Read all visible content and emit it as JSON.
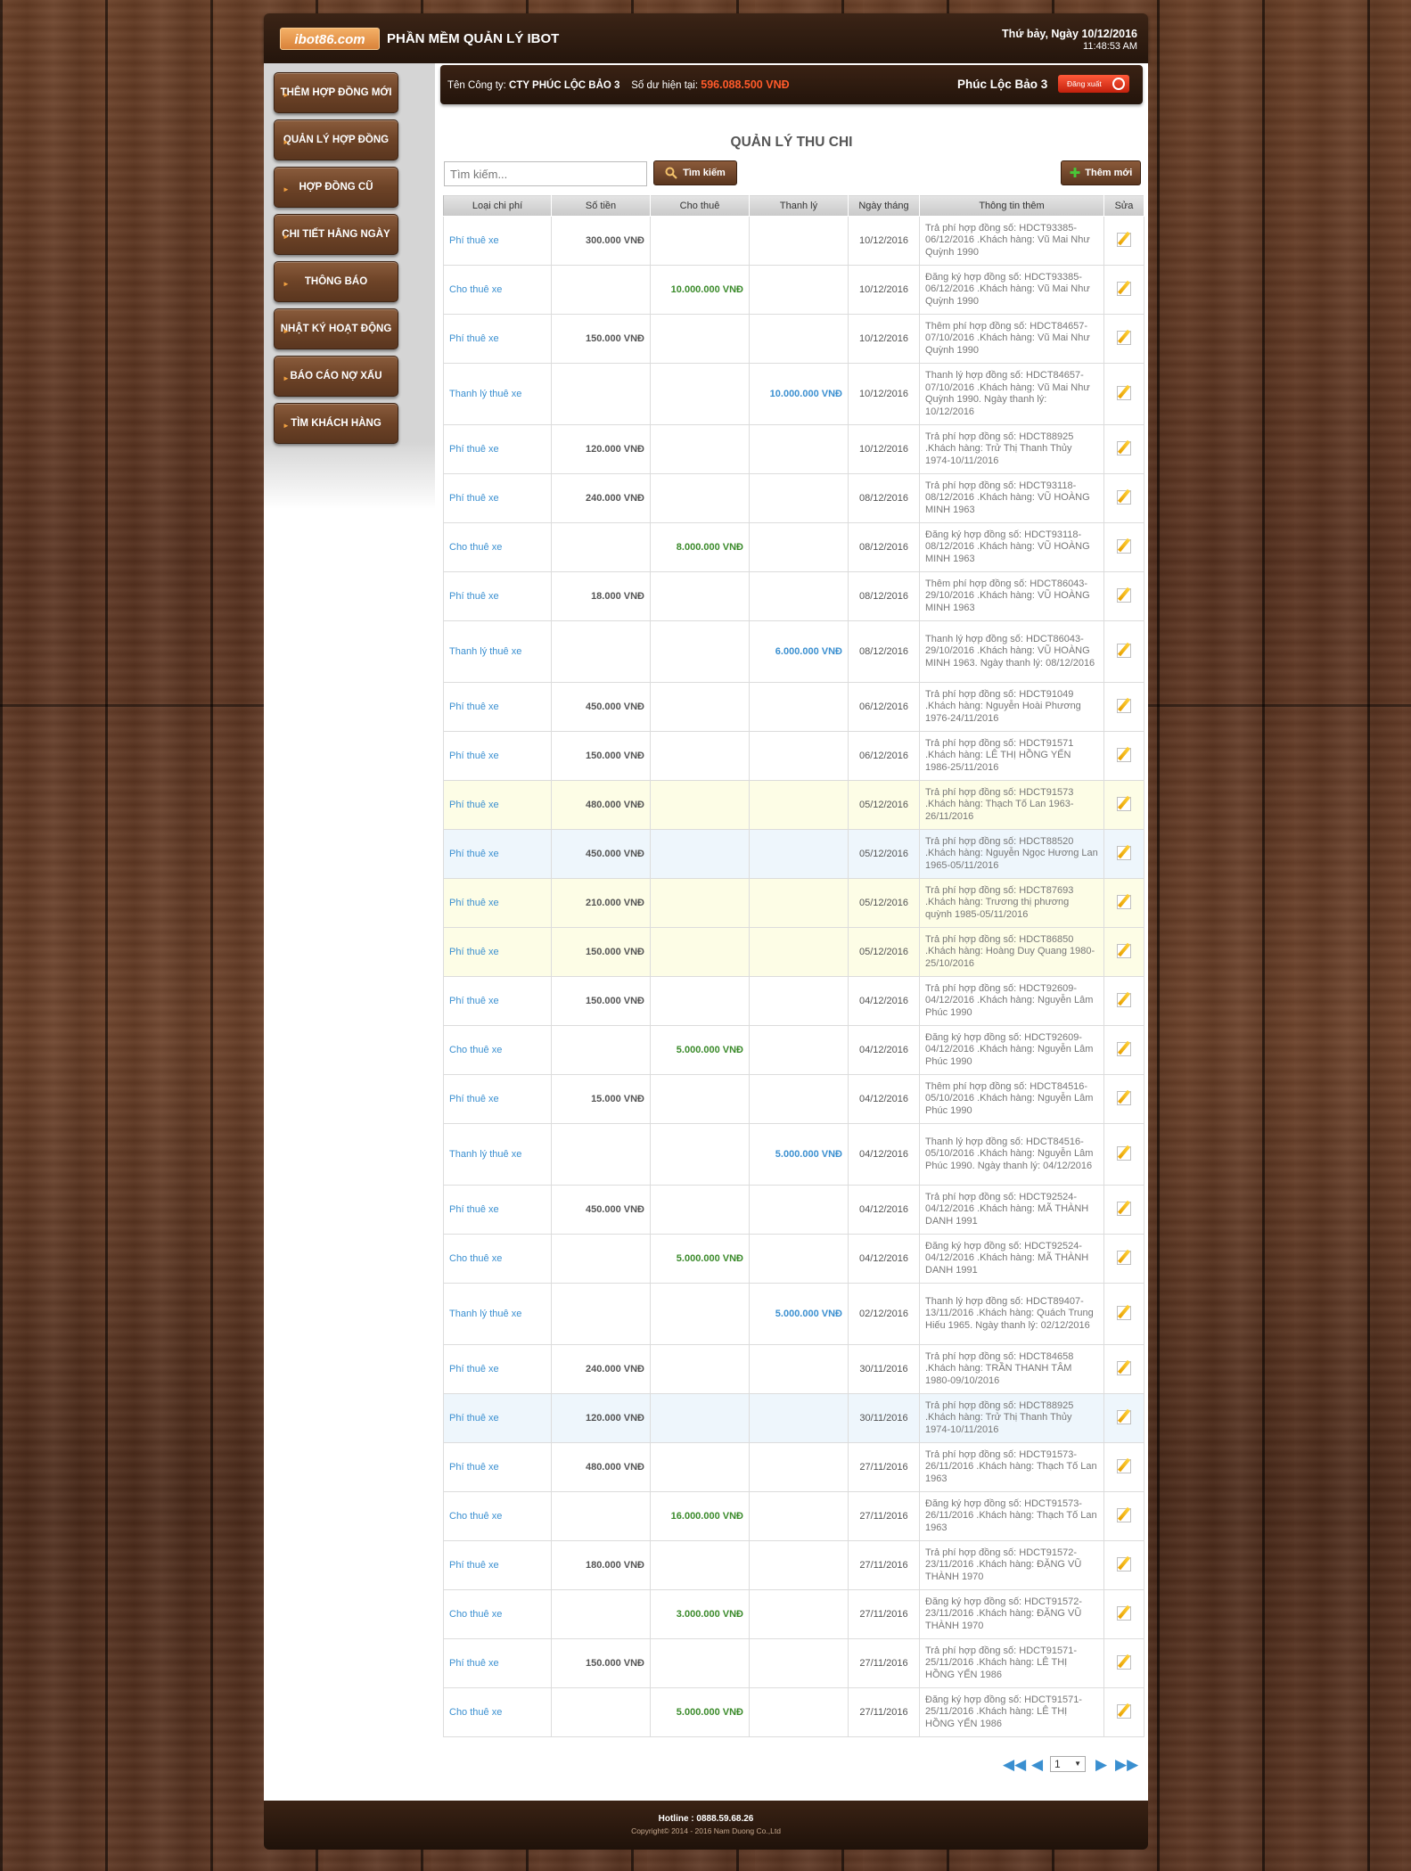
{
  "header": {
    "logo_text": "ibot86.com",
    "app_title": "PHẦN MỀM QUẢN LÝ IBOT",
    "date": "Thứ bảy, Ngày 10/12/2016",
    "time": "11:48:53 AM"
  },
  "sidebar": {
    "items": [
      {
        "label": "THÊM HỢP ĐỒNG MỚI"
      },
      {
        "label": "QUẢN LÝ HỢP ĐỒNG"
      },
      {
        "label": "HỢP ĐỒNG CŨ"
      },
      {
        "label": "CHI TIẾT HẰNG NGÀY"
      },
      {
        "label": "THÔNG BÁO"
      },
      {
        "label": "NHẬT KÝ HOẠT ĐỘNG"
      },
      {
        "label": "BÁO CÁO NỢ XẤU"
      },
      {
        "label": "TÌM KHÁCH HÀNG"
      }
    ]
  },
  "company_bar": {
    "company_label": "Tên Công ty: ",
    "company_name": "CTY PHÚC LỘC BẢO 3",
    "balance_label": "Số dư hiện tại: ",
    "balance_value": "596.088.500 VNĐ",
    "user_name": "Phúc Lộc Bảo 3",
    "logout_label": "Đăng xuất"
  },
  "page_title": "QUẢN LÝ THU CHI",
  "search": {
    "placeholder": "Tìm kiếm...",
    "button_label": "Tìm kiếm"
  },
  "add_button_label": "Thêm mới",
  "table": {
    "columns": [
      "Loại chi phí",
      "Số tiền",
      "Cho thuê",
      "Thanh lý",
      "Ngày tháng",
      "Thông tin thêm",
      "Sửa"
    ],
    "rows": [
      {
        "type": "Phí thuê xe",
        "amount": "300.000 VNĐ",
        "rent": "",
        "liq": "",
        "date": "10/12/2016",
        "info": "Trả phí hợp đồng số: HDCT93385-06/12/2016 .Khách hàng: Vũ Mai Như Quỳnh 1990",
        "tone": "white"
      },
      {
        "type": "Cho thuê xe",
        "amount": "",
        "rent": "10.000.000 VNĐ",
        "liq": "",
        "date": "10/12/2016",
        "info": "Đăng ký hợp đồng số: HDCT93385-06/12/2016 .Khách hàng: Vũ Mai Như Quỳnh 1990",
        "tone": "white"
      },
      {
        "type": "Phí thuê xe",
        "amount": "150.000 VNĐ",
        "rent": "",
        "liq": "",
        "date": "10/12/2016",
        "info": "Thêm phí hợp đồng số: HDCT84657-07/10/2016 .Khách hàng: Vũ Mai Như Quỳnh 1990",
        "tone": "white"
      },
      {
        "type": "Thanh lý thuê xe",
        "amount": "",
        "rent": "",
        "liq": "10.000.000 VNĐ",
        "date": "10/12/2016",
        "info": "Thanh lý hợp đồng số: HDCT84657-07/10/2016 .Khách hàng: Vũ Mai Như Quỳnh 1990. Ngày thanh lý: 10/12/2016",
        "tone": "white"
      },
      {
        "type": "Phí thuê xe",
        "amount": "120.000 VNĐ",
        "rent": "",
        "liq": "",
        "date": "10/12/2016",
        "info": "Trả phí hợp đồng số: HDCT88925 .Khách hàng: Trử Thị Thanh Thủy 1974-10/11/2016",
        "tone": "white"
      },
      {
        "type": "Phí thuê xe",
        "amount": "240.000 VNĐ",
        "rent": "",
        "liq": "",
        "date": "08/12/2016",
        "info": "Trả phí hợp đồng số: HDCT93118-08/12/2016 .Khách hàng: VŨ HOÀNG MINH 1963",
        "tone": "white"
      },
      {
        "type": "Cho thuê xe",
        "amount": "",
        "rent": "8.000.000 VNĐ",
        "liq": "",
        "date": "08/12/2016",
        "info": "Đăng ký hợp đồng số: HDCT93118-08/12/2016 .Khách hàng: VŨ HOÀNG MINH 1963",
        "tone": "white"
      },
      {
        "type": "Phí thuê xe",
        "amount": "18.000 VNĐ",
        "rent": "",
        "liq": "",
        "date": "08/12/2016",
        "info": "Thêm phí hợp đồng số: HDCT86043-29/10/2016 .Khách hàng: VŨ HOÀNG MINH 1963",
        "tone": "white"
      },
      {
        "type": "Thanh lý thuê xe",
        "amount": "",
        "rent": "",
        "liq": "6.000.000 VNĐ",
        "date": "08/12/2016",
        "info": "Thanh lý hợp đồng số: HDCT86043-29/10/2016 .Khách hàng: VŨ HOÀNG MINH 1963. Ngày thanh lý: 08/12/2016",
        "tone": "white"
      },
      {
        "type": "Phí thuê xe",
        "amount": "450.000 VNĐ",
        "rent": "",
        "liq": "",
        "date": "06/12/2016",
        "info": "Trả phí hợp đồng số: HDCT91049 .Khách hàng: Nguyễn Hoài Phương 1976-24/11/2016",
        "tone": "white"
      },
      {
        "type": "Phí thuê xe",
        "amount": "150.000 VNĐ",
        "rent": "",
        "liq": "",
        "date": "06/12/2016",
        "info": "Trả phí hợp đồng số: HDCT91571 .Khách hàng: LÊ THỊ HỒNG YẾN 1986-25/11/2016",
        "tone": "white"
      },
      {
        "type": "Phí thuê xe",
        "amount": "480.000 VNĐ",
        "rent": "",
        "liq": "",
        "date": "05/12/2016",
        "info": "Trả phí hợp đồng số: HDCT91573 .Khách hàng: Thạch Tố Lan 1963-26/11/2016",
        "tone": "yellow"
      },
      {
        "type": "Phí thuê xe",
        "amount": "450.000 VNĐ",
        "rent": "",
        "liq": "",
        "date": "05/12/2016",
        "info": "Trả phí hợp đồng số: HDCT88520 .Khách hàng: Nguyễn Ngọc Hương Lan 1965-05/11/2016",
        "tone": "blue"
      },
      {
        "type": "Phí thuê xe",
        "amount": "210.000 VNĐ",
        "rent": "",
        "liq": "",
        "date": "05/12/2016",
        "info": "Trả phí hợp đồng số: HDCT87693 .Khách hàng: Trương thị phương quỳnh 1985-05/11/2016",
        "tone": "yellow"
      },
      {
        "type": "Phí thuê xe",
        "amount": "150.000 VNĐ",
        "rent": "",
        "liq": "",
        "date": "05/12/2016",
        "info": "Trả phí hợp đồng số: HDCT86850 .Khách hàng: Hoàng Duy Quang 1980-25/10/2016",
        "tone": "yellow"
      },
      {
        "type": "Phí thuê xe",
        "amount": "150.000 VNĐ",
        "rent": "",
        "liq": "",
        "date": "04/12/2016",
        "info": "Trả phí hợp đồng số: HDCT92609-04/12/2016 .Khách hàng: Nguyễn Lâm Phúc 1990",
        "tone": "white"
      },
      {
        "type": "Cho thuê xe",
        "amount": "",
        "rent": "5.000.000 VNĐ",
        "liq": "",
        "date": "04/12/2016",
        "info": "Đăng ký hợp đồng số: HDCT92609-04/12/2016 .Khách hàng: Nguyễn Lâm Phúc 1990",
        "tone": "white"
      },
      {
        "type": "Phí thuê xe",
        "amount": "15.000 VNĐ",
        "rent": "",
        "liq": "",
        "date": "04/12/2016",
        "info": "Thêm phí hợp đồng số: HDCT84516-05/10/2016 .Khách hàng: Nguyễn Lâm Phúc 1990",
        "tone": "white"
      },
      {
        "type": "Thanh lý thuê xe",
        "amount": "",
        "rent": "",
        "liq": "5.000.000 VNĐ",
        "date": "04/12/2016",
        "info": "Thanh lý hợp đồng số: HDCT84516-05/10/2016 .Khách hàng: Nguyễn Lâm Phúc 1990. Ngày thanh lý: 04/12/2016",
        "tone": "white"
      },
      {
        "type": "Phí thuê xe",
        "amount": "450.000 VNĐ",
        "rent": "",
        "liq": "",
        "date": "04/12/2016",
        "info": "Trả phí hợp đồng số: HDCT92524-04/12/2016 .Khách hàng: MÃ THÀNH DANH 1991",
        "tone": "white"
      },
      {
        "type": "Cho thuê xe",
        "amount": "",
        "rent": "5.000.000 VNĐ",
        "liq": "",
        "date": "04/12/2016",
        "info": "Đăng ký hợp đồng số: HDCT92524-04/12/2016 .Khách hàng: MÃ THÀNH DANH 1991",
        "tone": "white"
      },
      {
        "type": "Thanh lý thuê xe",
        "amount": "",
        "rent": "",
        "liq": "5.000.000 VNĐ",
        "date": "02/12/2016",
        "info": "Thanh lý hợp đồng số: HDCT89407-13/11/2016 .Khách hàng: Quách Trung Hiếu 1965. Ngày thanh lý: 02/12/2016",
        "tone": "white"
      },
      {
        "type": "Phí thuê xe",
        "amount": "240.000 VNĐ",
        "rent": "",
        "liq": "",
        "date": "30/11/2016",
        "info": "Trả phí hợp đồng số: HDCT84658 .Khách hàng: TRẦN THANH TÂM 1980-09/10/2016",
        "tone": "white"
      },
      {
        "type": "Phí thuê xe",
        "amount": "120.000 VNĐ",
        "rent": "",
        "liq": "",
        "date": "30/11/2016",
        "info": "Trả phí hợp đồng số: HDCT88925 .Khách hàng: Trử Thị Thanh Thủy 1974-10/11/2016",
        "tone": "blue"
      },
      {
        "type": "Phí thuê xe",
        "amount": "480.000 VNĐ",
        "rent": "",
        "liq": "",
        "date": "27/11/2016",
        "info": "Trả phí hợp đồng số: HDCT91573-26/11/2016 .Khách hàng: Thạch Tố Lan 1963",
        "tone": "white"
      },
      {
        "type": "Cho thuê xe",
        "amount": "",
        "rent": "16.000.000 VNĐ",
        "liq": "",
        "date": "27/11/2016",
        "info": "Đăng ký hợp đồng số: HDCT91573-26/11/2016 .Khách hàng: Thạch Tố Lan 1963",
        "tone": "white"
      },
      {
        "type": "Phí thuê xe",
        "amount": "180.000 VNĐ",
        "rent": "",
        "liq": "",
        "date": "27/11/2016",
        "info": "Trả phí hợp đồng số: HDCT91572-23/11/2016 .Khách hàng: ĐẶNG VŨ THÀNH 1970",
        "tone": "white"
      },
      {
        "type": "Cho thuê xe",
        "amount": "",
        "rent": "3.000.000 VNĐ",
        "liq": "",
        "date": "27/11/2016",
        "info": "Đăng ký hợp đồng số: HDCT91572-23/11/2016 .Khách hàng: ĐẶNG VŨ THÀNH 1970",
        "tone": "white"
      },
      {
        "type": "Phí thuê xe",
        "amount": "150.000 VNĐ",
        "rent": "",
        "liq": "",
        "date": "27/11/2016",
        "info": "Trả phí hợp đồng số: HDCT91571-25/11/2016 .Khách hàng: LÊ THỊ HỒNG YẾN 1986",
        "tone": "white"
      },
      {
        "type": "Cho thuê xe",
        "amount": "",
        "rent": "5.000.000 VNĐ",
        "liq": "",
        "date": "27/11/2016",
        "info": "Đăng ký hợp đồng số: HDCT91571-25/11/2016 .Khách hàng: LÊ THỊ HỒNG YẾN 1986",
        "tone": "white"
      }
    ]
  },
  "pagination": {
    "current_page": "1"
  },
  "footer": {
    "hotline": "Hotline : 0888.59.68.26",
    "copyright": "Copyright© 2014 - 2016 Nam Duong Co.,Ltd"
  },
  "icons": {
    "search": "search-icon",
    "add": "plus-icon",
    "edit": "edit-pencil-icon",
    "logout": "power-icon",
    "pager": [
      "first-page-icon",
      "prev-page-icon",
      "next-page-icon",
      "last-page-icon"
    ]
  }
}
